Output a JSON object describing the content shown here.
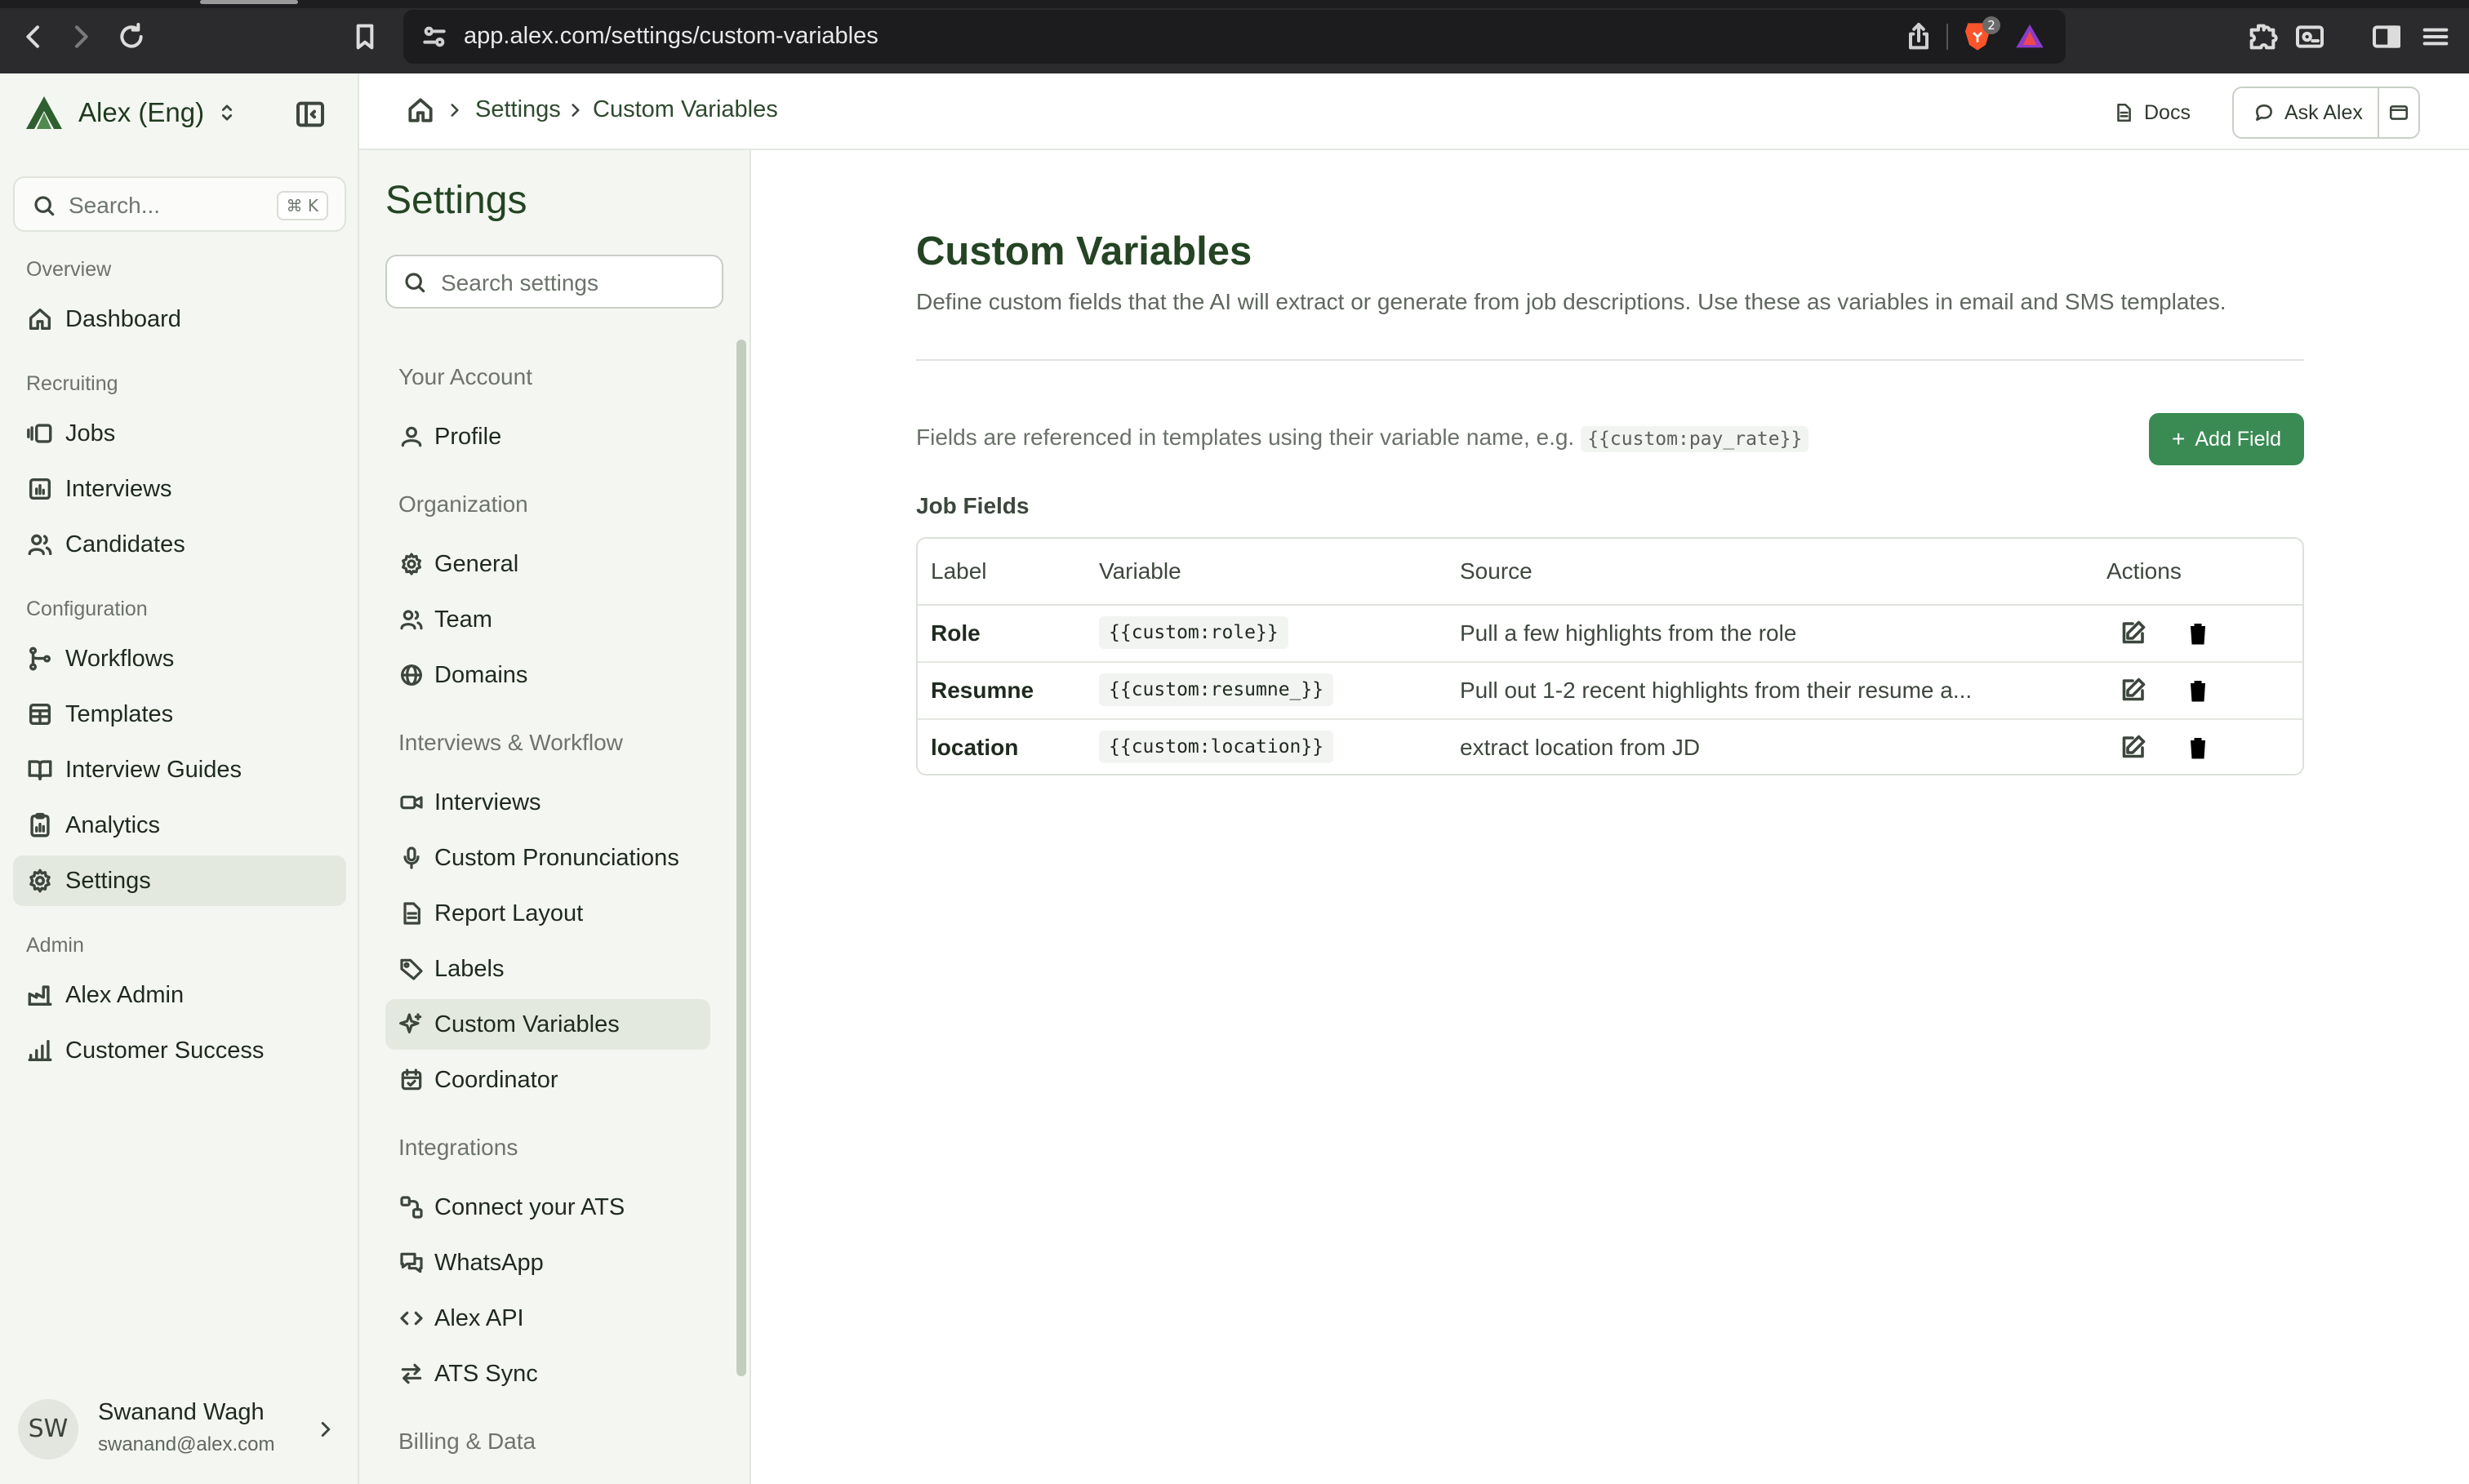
{
  "browser": {
    "url": "app.alex.com/settings/custom-variables",
    "shields_count": "2"
  },
  "sidebar": {
    "workspace": "Alex (Eng)",
    "search_placeholder": "Search...",
    "search_shortcut": "⌘ K",
    "sections": {
      "overview": "Overview",
      "recruiting": "Recruiting",
      "configuration": "Configuration",
      "admin": "Admin"
    },
    "items": {
      "dashboard": "Dashboard",
      "jobs": "Jobs",
      "interviews": "Interviews",
      "candidates": "Candidates",
      "workflows": "Workflows",
      "templates": "Templates",
      "interview_guides": "Interview Guides",
      "analytics": "Analytics",
      "settings": "Settings",
      "alex_admin": "Alex Admin",
      "customer_success": "Customer Success"
    },
    "user": {
      "initials": "SW",
      "name": "Swanand Wagh",
      "email": "swanand@alex.com"
    }
  },
  "header": {
    "breadcrumb": [
      "Settings",
      "Custom Variables"
    ],
    "docs_label": "Docs",
    "ask_label": "Ask Alex"
  },
  "settings_nav": {
    "title": "Settings",
    "search_placeholder": "Search settings",
    "sections": {
      "account": "Your Account",
      "organization": "Organization",
      "interviews_workflow": "Interviews & Workflow",
      "integrations": "Integrations",
      "billing": "Billing & Data"
    },
    "items": {
      "profile": "Profile",
      "general": "General",
      "team": "Team",
      "domains": "Domains",
      "interviews": "Interviews",
      "custom_pronunciations": "Custom Pronunciations",
      "report_layout": "Report Layout",
      "labels": "Labels",
      "custom_variables": "Custom Variables",
      "coordinator": "Coordinator",
      "connect_ats": "Connect your ATS",
      "whatsapp": "WhatsApp",
      "alex_api": "Alex API",
      "ats_sync": "ATS Sync"
    }
  },
  "main": {
    "title": "Custom Variables",
    "description": "Define custom fields that the AI will extract or generate from job descriptions. Use these as variables in email and SMS templates.",
    "reference_note": "Fields are referenced in templates using their variable name, e.g.",
    "reference_example": "{{custom:pay_rate}}",
    "add_button": "Add Field",
    "section_title": "Job Fields",
    "table": {
      "headers": {
        "label": "Label",
        "variable": "Variable",
        "source": "Source",
        "actions": "Actions"
      },
      "rows": [
        {
          "label": "Role",
          "variable": "{{custom:role}}",
          "source": "Pull a few highlights from the role"
        },
        {
          "label": "Resumne",
          "variable": "{{custom:resumne_}}",
          "source": "Pull out 1-2 recent highlights from their resume a..."
        },
        {
          "label": "location",
          "variable": "{{custom:location}}",
          "source": "extract location from JD"
        }
      ]
    }
  }
}
